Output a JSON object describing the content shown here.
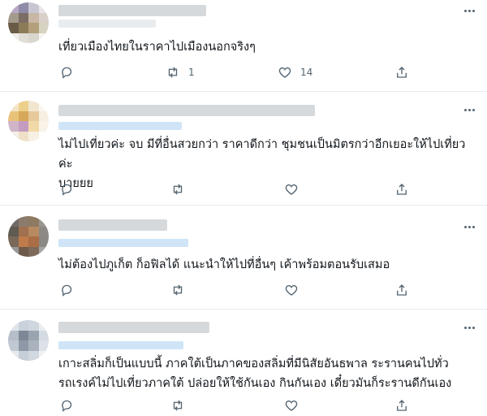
{
  "tweets": [
    {
      "text": "เที่ยวเมืองไทยในราคาไปเมืองนอกจริงๆ",
      "reply_count": "",
      "retweet_count": "1",
      "like_count": "14",
      "avatar_colors": [
        "#b8a8c6",
        "#8f8aa8",
        "#c9c6d3",
        "#e8e4ea",
        "#a49a8c",
        "#7b6d66",
        "#c8b7a4",
        "#d9d0c9",
        "#6a5b46",
        "#8c7b57",
        "#b39f7a",
        "#d8d2c1",
        "#f0eee8",
        "#e0ddd6",
        "#d9d6ce",
        "#f5f4f0"
      ]
    },
    {
      "text": "ไม่ไปเที่ยวค่ะ จบ มีที่อื่นสวยกว่า ราคาดีกว่า ชุมชนเป็นมิตรกว่าอีกเยอะให้ไปเที่ยวค่ะ\nบายยย",
      "reply_count": "",
      "retweet_count": "",
      "like_count": "",
      "avatar_colors": [
        "#f4e3c5",
        "#ecd08a",
        "#f1e6d0",
        "#fbf7ef",
        "#e9c27a",
        "#d7a85a",
        "#e7c99b",
        "#f6eee1",
        "#d0b5c8",
        "#c39cc0",
        "#f2d9a8",
        "#f9f3e7",
        "#f5efe8",
        "#f0e0c8",
        "#f7f0e4",
        "#ffffff"
      ]
    },
    {
      "text": "ไม่ต้องไปภูเก็ต ก็อฟิลได้ แนะนำให้ไปที่อื่นๆ เค้าพร้อมตอนรับเสมอ",
      "reply_count": "",
      "retweet_count": "",
      "like_count": "",
      "avatar_colors": [
        "#6e6a66",
        "#8a7b6d",
        "#8e7a62",
        "#9a9590",
        "#5f5a52",
        "#a0704f",
        "#b78a62",
        "#8d8a86",
        "#7a6858",
        "#c07b4b",
        "#ab6d45",
        "#8b8885",
        "#9a9896",
        "#6e5a4a",
        "#7d6a5a",
        "#a7a5a2"
      ]
    },
    {
      "text": "เกาะสลิ่มก็เป็นแบบนี้ ภาคใต้เป็นภาคของสลิ่มที่มีนิสัยอันธพาล ระรานคนไปทั่ว\nรถเรงค์ไม่ไปเที่ยวภาคใต้ ปล่อยให้ใช้กันเอง กินกันเอง เดี๋ยวมันก็ระรานดีกันเอง",
      "reply_count": "",
      "retweet_count": "",
      "like_count": "",
      "avatar_colors": [
        "#dfe4ea",
        "#c9d1da",
        "#cfd6de",
        "#e9edf1",
        "#b6bfc9",
        "#7d8795",
        "#9aa4b1",
        "#d5dbe2",
        "#c0c8d2",
        "#8e98a6",
        "#a9b2bd",
        "#dde2e8",
        "#e6eaee",
        "#c6ced7",
        "#d2d8df",
        "#eef1f4"
      ]
    }
  ]
}
